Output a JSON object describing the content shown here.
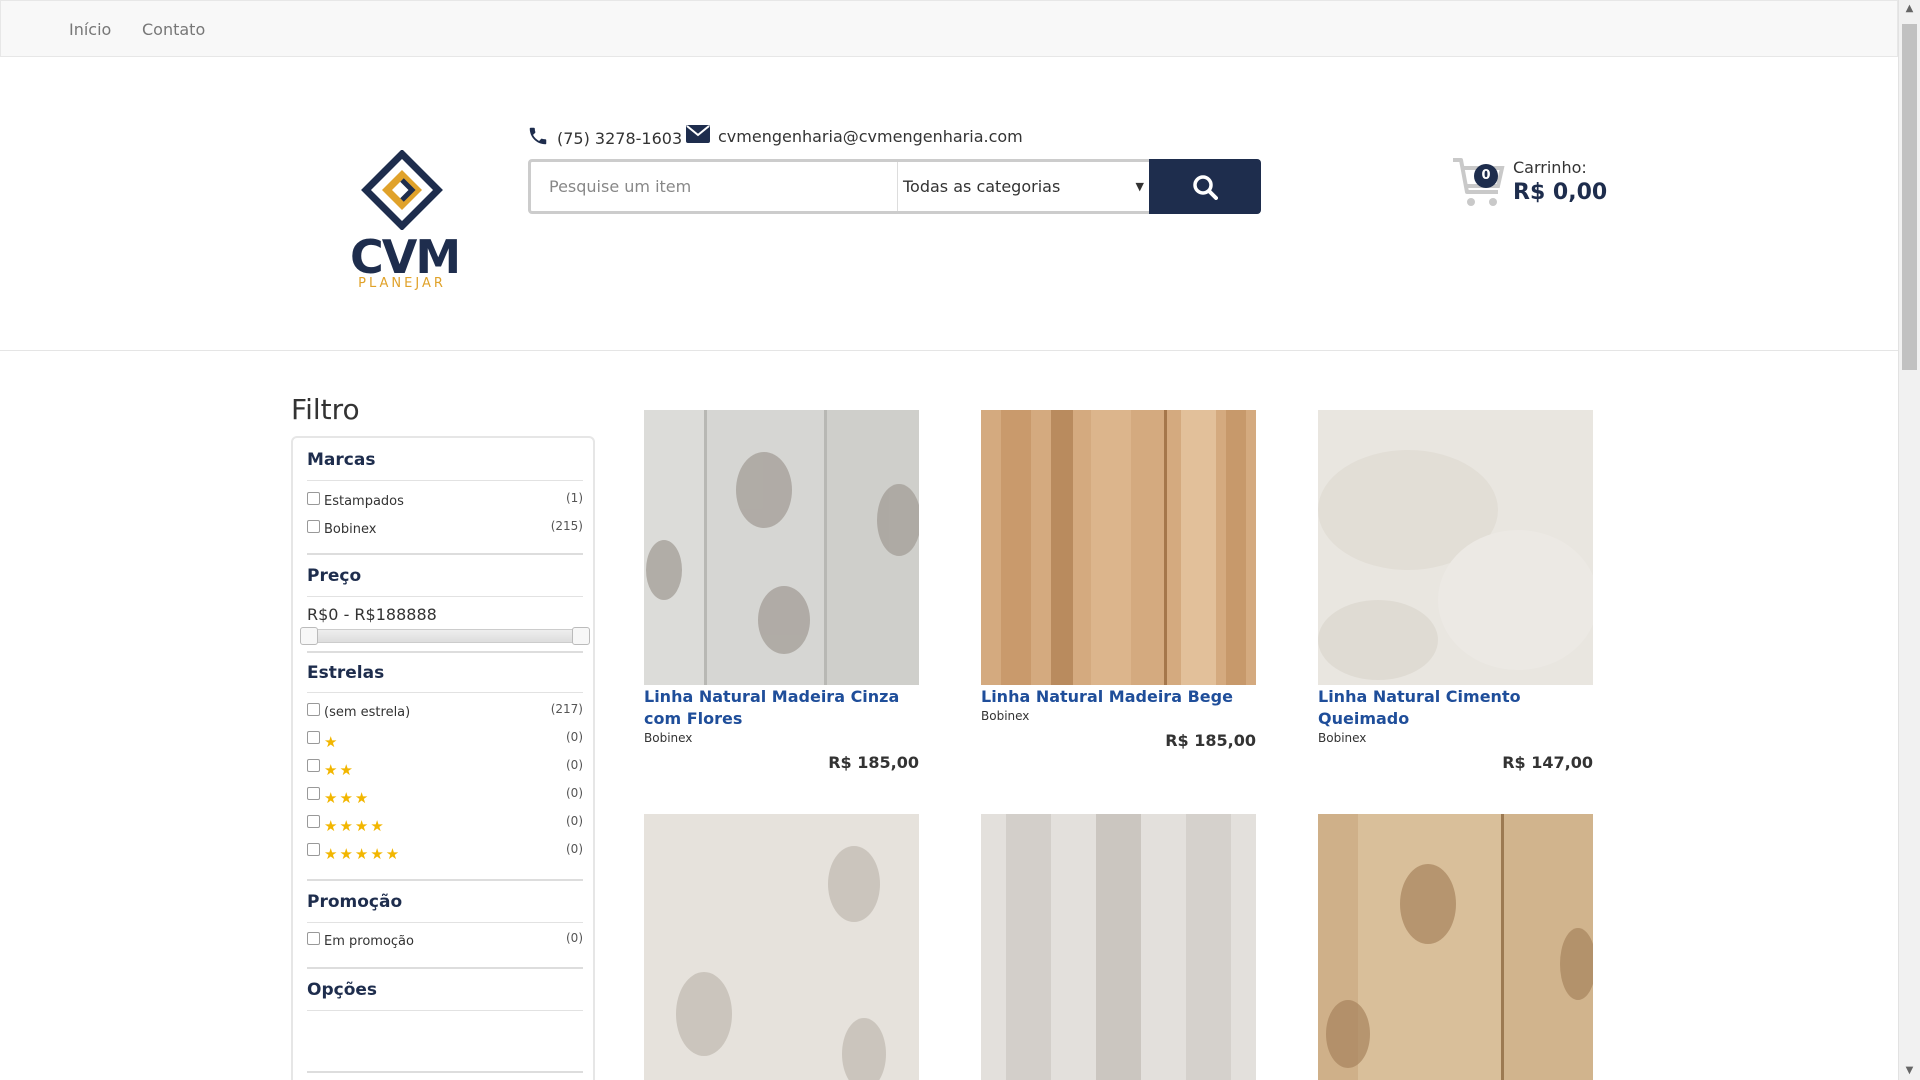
{
  "nav": {
    "items": [
      {
        "label": "Início"
      },
      {
        "label": "Contato"
      }
    ]
  },
  "header": {
    "logo": {
      "word": "CVM",
      "tagline": "PLANEJAR"
    },
    "phone": "(75) 3278-1603",
    "email": "cvmengenharia@cvmengenharia.com",
    "search": {
      "placeholder": "Pesquise um item",
      "category": "Todas as categorias"
    },
    "cart": {
      "count": "0",
      "label": "Carrinho:",
      "value": "R$ 0,00"
    }
  },
  "filter": {
    "title": "Filtro",
    "brands": {
      "title": "Marcas",
      "items": [
        {
          "label": "Estampados",
          "count": "(1)"
        },
        {
          "label": "Bobinex",
          "count": "(215)"
        }
      ]
    },
    "price": {
      "title": "Preço",
      "range": "R$0 - R$188888"
    },
    "stars": {
      "title": "Estrelas",
      "items": [
        {
          "label": "(sem estrela)",
          "stars": 0,
          "count": "(217)"
        },
        {
          "stars": 1,
          "count": "(0)"
        },
        {
          "stars": 2,
          "count": "(0)"
        },
        {
          "stars": 3,
          "count": "(0)"
        },
        {
          "stars": 4,
          "count": "(0)"
        },
        {
          "stars": 5,
          "count": "(0)"
        }
      ]
    },
    "promo": {
      "title": "Promoção",
      "items": [
        {
          "label": "Em promoção",
          "count": "(0)"
        }
      ]
    },
    "options": {
      "title": "Opções"
    }
  },
  "products": [
    {
      "name": "Linha Natural Madeira Cinza com Flores",
      "brand": "Bobinex",
      "price": "R$ 185,00"
    },
    {
      "name": "Linha Natural Madeira Bege",
      "brand": "Bobinex",
      "price": "R$ 185,00"
    },
    {
      "name": "Linha Natural Cimento Queimado",
      "brand": "Bobinex",
      "price": "R$ 147,00"
    },
    {
      "name": "",
      "brand": "",
      "price": ""
    },
    {
      "name": "",
      "brand": "",
      "price": ""
    },
    {
      "name": "",
      "brand": "",
      "price": ""
    }
  ]
}
